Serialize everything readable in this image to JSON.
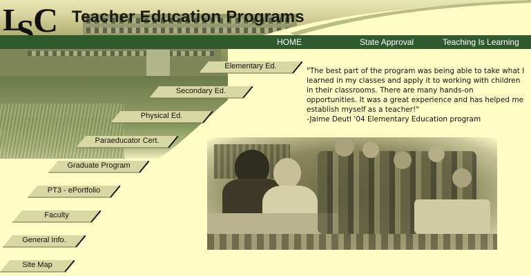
{
  "logo": {
    "text": "LSC"
  },
  "header": {
    "title": "Teacher Education Programs"
  },
  "topnav": {
    "items": [
      {
        "label": "HOME"
      },
      {
        "label": "State Approval"
      },
      {
        "label": "Teaching Is Learning"
      }
    ]
  },
  "menu": {
    "items": [
      {
        "label": "Elementary Ed."
      },
      {
        "label": "Secondary Ed."
      },
      {
        "label": "Physical Ed."
      },
      {
        "label": "Paraeducator Cert."
      },
      {
        "label": "Graduate Program"
      },
      {
        "label": "PT3 - ePortfolio"
      },
      {
        "label": "Faculty"
      },
      {
        "label": "General Info."
      },
      {
        "label": "Site Map"
      }
    ]
  },
  "testimonial": {
    "quote": "\"The best part of the program was being able to take what I learned in my classes and apply it to working with children in their classrooms. There are many hands-on opportunities. It was a great experience and has helped me establish myself as a teacher!\"",
    "attribution": "-Jaime Deutl '04 Elementary Education program"
  },
  "colors": {
    "background": "#fefdc6",
    "nav_bar": "#2f5a2d",
    "button": "#d8d8a4",
    "button_shadow": "#1a1a10"
  }
}
